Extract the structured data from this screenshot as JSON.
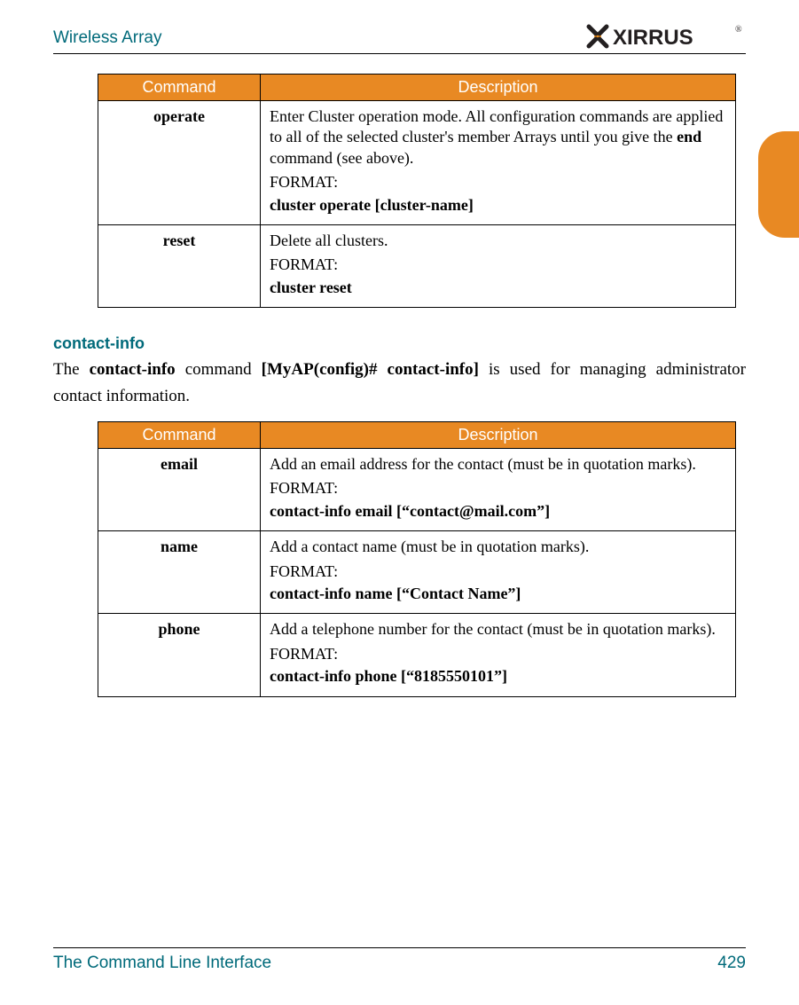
{
  "header": {
    "title": "Wireless Array",
    "logo_text": "XIRRUS"
  },
  "side_tab": {},
  "tables": {
    "headers": {
      "command": "Command",
      "description": "Description"
    },
    "cluster": [
      {
        "command": "operate",
        "desc_pre": "Enter Cluster operation mode. All configuration commands are applied to all of the selected cluster's member Arrays until you give the ",
        "desc_bold": "end",
        "desc_post": " command (see above).",
        "format_label": "FORMAT:",
        "format_text": "cluster operate [cluster-name]"
      },
      {
        "command": "reset",
        "desc_pre": "Delete all clusters.",
        "desc_bold": "",
        "desc_post": "",
        "format_label": "FORMAT:",
        "format_text": "cluster reset"
      }
    ],
    "contact": [
      {
        "command": "email",
        "desc_pre": "Add an email address for the contact (must be in quotation marks).",
        "desc_bold": "",
        "desc_post": "",
        "format_label": "FORMAT:",
        "format_text": "contact-info email [“contact@mail.com”]"
      },
      {
        "command": "name",
        "desc_pre": "Add a contact name (must be in quotation marks).",
        "desc_bold": "",
        "desc_post": "",
        "format_label": "FORMAT:",
        "format_text": "contact-info name [“Contact Name”]"
      },
      {
        "command": "phone",
        "desc_pre": "Add a telephone number for the contact (must be in quotation marks).",
        "desc_bold": "",
        "desc_post": "",
        "format_label": "FORMAT:",
        "format_text": "contact-info phone [“8185550101”]"
      }
    ]
  },
  "section": {
    "heading": "contact-info",
    "intro_pre": "The ",
    "intro_b1": "contact-info",
    "intro_mid1": " command ",
    "intro_b2": "[MyAP(config)# contact-info]",
    "intro_post": " is used for managing administrator contact information."
  },
  "footer": {
    "left": "The Command Line Interface",
    "right": "429"
  }
}
